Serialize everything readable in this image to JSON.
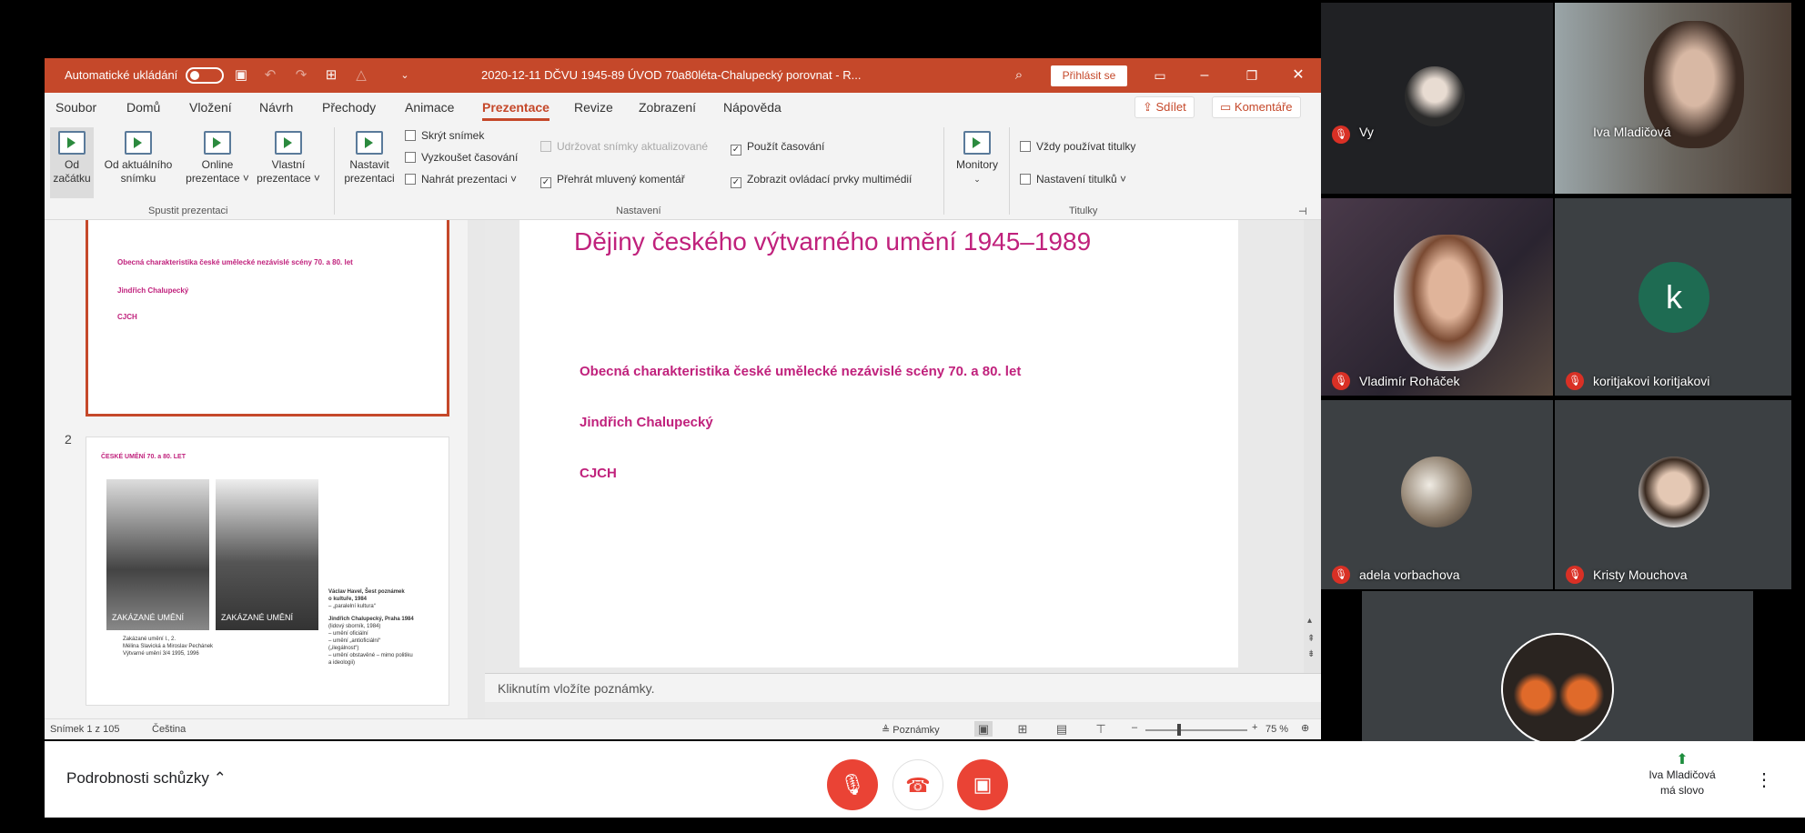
{
  "ppt": {
    "autosave_label": "Automatické ukládání",
    "doc_title": "2020-12-11 DČVU 1945-89 ÚVOD 70a80léta-Chalupecký porovnat - R...",
    "signin": "Přihlásit se",
    "tabs": [
      "Soubor",
      "Domů",
      "Vložení",
      "Návrh",
      "Přechody",
      "Animace",
      "Prezentace",
      "Revize",
      "Zobrazení",
      "Nápověda"
    ],
    "share": "Sdílet",
    "comments": "Komentáře",
    "ribbon": {
      "from_start": "Od\nzačátku",
      "from_current": "Od aktuálního\nsnímku",
      "online": "Online\nprezentace ˅",
      "custom": "Vlastní\nprezentace ˅",
      "group_start": "Spustit prezentaci",
      "setup": "Nastavit\nprezentaci",
      "hide_slide": "Skrýt snímek",
      "rehearse": "Vyzkoušet časování",
      "record": "Nahrát prezentaci ˅",
      "keep_updated": "Udržovat snímky aktualizované",
      "play_narration": "Přehrát mluvený komentář",
      "use_timings": "Použít časování",
      "show_media": "Zobrazit ovládací prvky multimédií",
      "group_setup": "Nastavení",
      "monitors": "Monitory",
      "always_subtitles": "Vždy používat titulky",
      "subtitle_settings": "Nastavení titulků ˅",
      "group_captions": "Titulky"
    },
    "thumb1": {
      "line1": "Obecná charakteristika české umělecké nezávislé scény 70. a 80. let",
      "line2": "Jindřich Chalupecký",
      "line3": "CJCH"
    },
    "thumb2": {
      "num": "2",
      "title": "ČESKÉ UMĚNÍ 70. a 80. LET",
      "photo_caption": "ZAKÁZANÉ UMĚNÍ",
      "cap1": "Zakázané umění I., 2.",
      "cap2": "Mélina Slavická a Miroslav Pechánek",
      "cap3": "Výtvarné umění 3/4 1995, 1996",
      "r1": "Václav Havel, Šest poznámek",
      "r2": "o kultuře, 1984",
      "r3": "– „paralelní kultura“",
      "r4": "Jindřich Chalupecký, Praha 1984",
      "r5": "(lidový sborník, 1984)",
      "r6": "– umění oficiální",
      "r7": "– umění „antioficiální“",
      "r8": "(„ilegálnost“)",
      "r9": "– umění obstavěné – mimo politiku",
      "r10": "a ideologii)"
    },
    "slide": {
      "title": "Dějiny českého výtvarného umění 1945–1989",
      "line1": "Obecná charakteristika české umělecké nezávislé scény 70. a 80. let",
      "line2": "Jindřich Chalupecký",
      "line3": "CJCH"
    },
    "notes_placeholder": "Kliknutím vložíte poznámky.",
    "status": {
      "slide": "Snímek 1 z 105",
      "lang": "Čeština",
      "notes": "Poznámky",
      "zoom": "75 %"
    },
    "accent": "#c5482a",
    "slide_pink": "#c0217c"
  },
  "meet": {
    "participants": [
      {
        "name": "Vy",
        "muted": true
      },
      {
        "name": "Iva Mladičová",
        "muted": false
      },
      {
        "name": "Vladimír Roháček",
        "muted": true
      },
      {
        "name": "koritjakovi koritjakovi",
        "muted": true,
        "initial": "k"
      },
      {
        "name": "adela vorbachova",
        "muted": true
      },
      {
        "name": "Kristy Mouchova",
        "muted": true
      }
    ],
    "details": "Podrobnosti schůzky",
    "presenter_line1": "Iva Mladičová",
    "presenter_line2": "má slovo",
    "avatar_k_color": "#1e6b52",
    "mic_off_color": "#d93025"
  }
}
